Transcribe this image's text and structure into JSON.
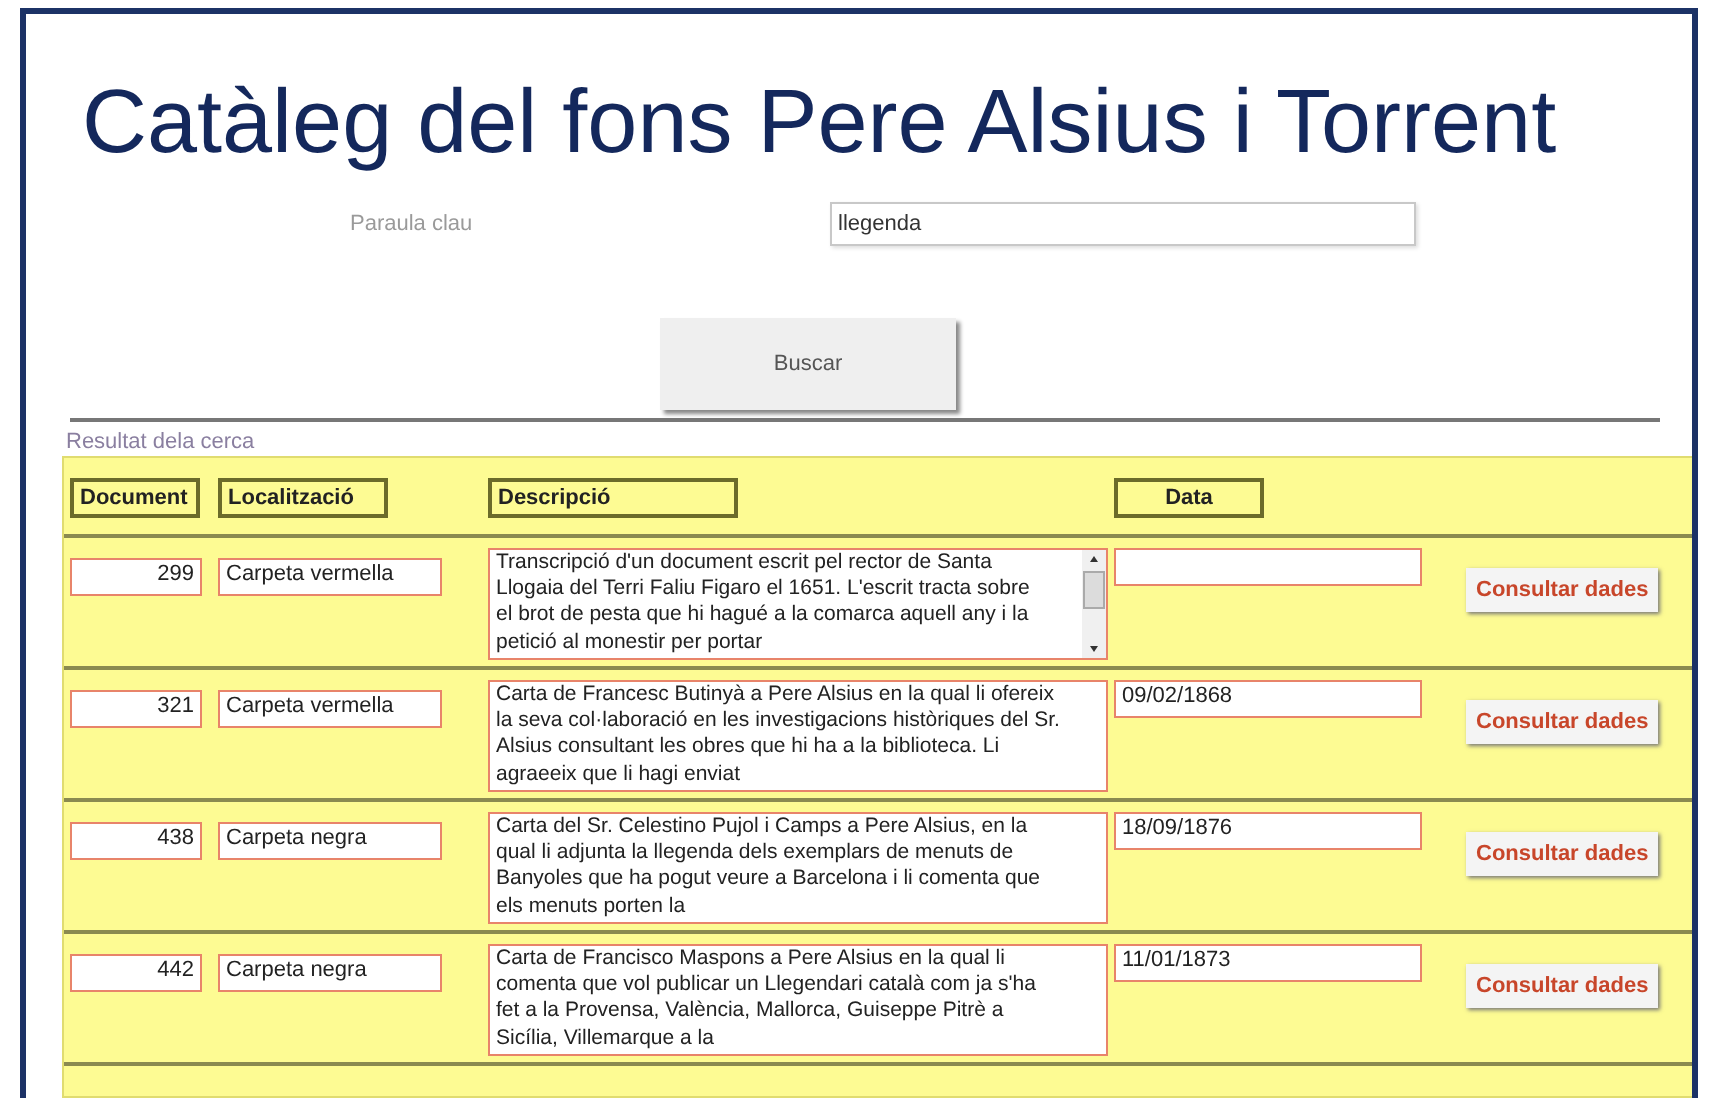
{
  "title": "Catàleg del fons Pere Alsius i Torrent",
  "search": {
    "label": "Paraula clau",
    "value": "llegenda",
    "button": "Buscar"
  },
  "results_label": "Resultat dela cerca",
  "table": {
    "columns": [
      "Document",
      "Localització",
      "Descripció",
      "Data"
    ],
    "rows": [
      {
        "document": "299",
        "location": "Carpeta vermella",
        "description": "Transcripció d'un document escrit pel rector de Santa Llogaia del Terri Faliu Figaro el 1651. L'escrit tracta sobre el brot de pesta que hi hagué a la comarca aquell any i la petició al monestir per portar",
        "scrollable": true,
        "date": "",
        "button": "Consultar dades"
      },
      {
        "document": "321",
        "location": "Carpeta vermella",
        "description": "Carta de Francesc Butinyà a Pere Alsius en la qual li ofereix la seva col·laboració en les investigacions històriques del Sr. Alsius consultant les obres que hi ha a la biblioteca. Li agraeeix que li hagi enviat",
        "scrollable": false,
        "date": "09/02/1868",
        "button": "Consultar dades"
      },
      {
        "document": "438",
        "location": "Carpeta negra",
        "description": "Carta del Sr. Celestino Pujol i Camps a Pere Alsius, en la qual li adjunta la llegenda dels exemplars de menuts de Banyoles que ha pogut veure a Barcelona i li comenta que els menuts porten la",
        "scrollable": false,
        "date": "18/09/1876",
        "button": "Consultar dades"
      },
      {
        "document": "442",
        "location": "Carpeta negra",
        "description": "Carta de Francisco Maspons a Pere Alsius en la qual li comenta que vol publicar un Llegendari català com ja s'ha fet a la Provensa, València, Mallorca, Guiseppe Pitrè a Sicília, Villemarque a la",
        "scrollable": false,
        "date": "11/01/1873",
        "button": "Consultar dades"
      }
    ]
  }
}
